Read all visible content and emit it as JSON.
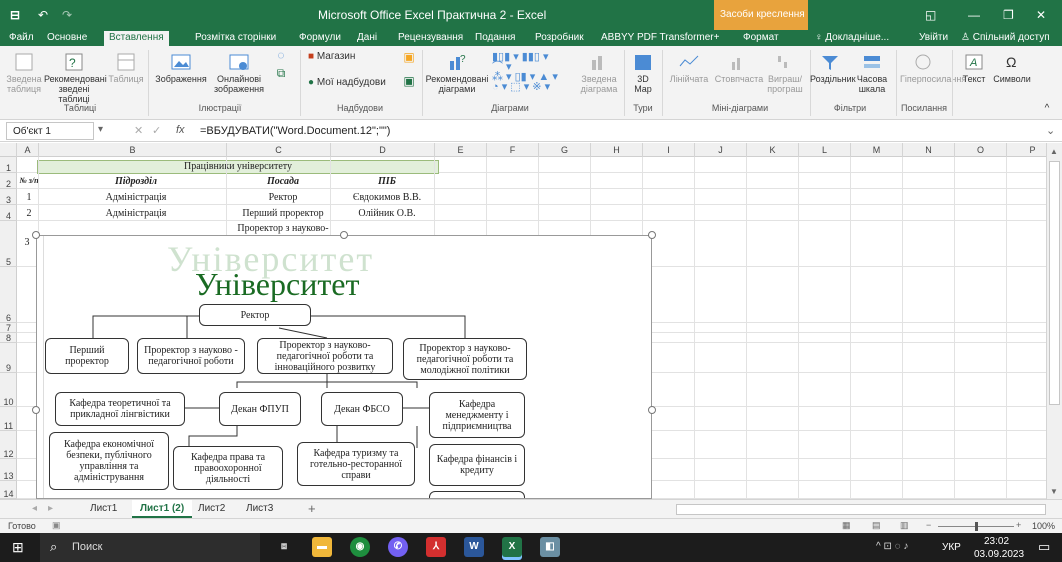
{
  "window": {
    "title": "Microsoft Office Excel Практична 2 - Excel",
    "tools_context": "Засоби креслення",
    "qat_undo": "↶",
    "qat_redo": "↷",
    "min": "—",
    "max": "❐",
    "close": "✕",
    "restore": "◱"
  },
  "tabs": [
    "Файл",
    "Основне",
    "Вставлення",
    "Розмітка сторінки",
    "Формули",
    "Дані",
    "Рецензування",
    "Подання",
    "Розробник",
    "ABBYY PDF Transformer+",
    "Формат"
  ],
  "tell_me": "Докладніше...",
  "sign_in": "Увійти",
  "share": "Спільний доступ",
  "ribbon": {
    "pivot": "Зведена таблиця",
    "rec_pivot": "Рекомендовані зведені таблиці",
    "table": "Таблиця",
    "pictures": "Зображення",
    "online_pictures": "Онлайнові зображення",
    "store": "Магазин",
    "my_addins": "Мої надбудови",
    "rec_charts": "Рекомендовані діаграми",
    "pivot_chart": "Зведена діаграма",
    "map3d": "3D Map",
    "line": "Лінійчата",
    "column": "Стовпчаста",
    "winloss": "Виграш/програш",
    "slicer": "Роздільник",
    "timeline": "Часова шкала",
    "link": "Гіперпосилання",
    "text": "Текст",
    "symbols": "Символи",
    "groups": [
      "Таблиці",
      "Ілюстрації",
      "Надбудови",
      "Діаграми",
      "Тури",
      "Міні-діаграми",
      "Фільтри",
      "Посилання"
    ]
  },
  "formula_bar": {
    "name_box": "Об'єкт 1",
    "fx": "fx",
    "formula": "=ВБУДУВАТИ(\"Word.Document.12\";\"\")"
  },
  "columns": [
    "A",
    "B",
    "C",
    "D",
    "E",
    "F",
    "G",
    "H",
    "I",
    "J",
    "K",
    "L",
    "M",
    "N",
    "O",
    "P"
  ],
  "rows": [
    "1",
    "2",
    "3",
    "4",
    "5",
    "6",
    "7",
    "8",
    "9",
    "10",
    "11",
    "12",
    "13",
    "14"
  ],
  "sheet": {
    "title": "Працівники університету",
    "headers": [
      "№ з/п",
      "Підрозділ",
      "Посада",
      "ПІБ"
    ],
    "r3": [
      "1",
      "Адміністрація",
      "Ректор",
      "Євдокимов В.В."
    ],
    "r4": [
      "2",
      "Адміністрація",
      "Перший проректор",
      "Олійник О.В."
    ],
    "r5_c": "Проректор з науково-",
    "r5_a": "3"
  },
  "diagram": {
    "watermark": "Університет",
    "title": "Університет",
    "rector": "Ректор",
    "l2": [
      "Перший проректор",
      "Проректор з науково - педагогічної роботи",
      "Проректор з науково-педагогічної роботи та інноваційного розвитку",
      "Проректор з науково-педагогічної роботи та молодіжної політики"
    ],
    "dean1": "Декан ФПУП",
    "dean2": "Декан ФБСО",
    "dept": [
      "Кафедра теоретичної та прикладної лінгвістики",
      "Кафедра економічної безпеки, публічного управління та адміністрування",
      "Кафедра права та правоохоронної діяльності",
      "Кафедра туризму та готельно-ресторанної справи",
      "Кафедра менеджменту і підприємництва",
      "Кафедра фінансів і кредиту"
    ],
    "row_nums": [
      "4",
      "5",
      "6",
      "7",
      "8",
      "9",
      "11",
      "12",
      "13"
    ]
  },
  "sheets": [
    "Лист1",
    "Лист1 (2)",
    "Лист2",
    "Лист3"
  ],
  "add_sheet": "+",
  "status": {
    "ready": "Готово",
    "zoom": "100%"
  },
  "taskbar": {
    "search": "Поиск",
    "lang": "УКР",
    "time": "23:02",
    "date": "03.09.2023"
  }
}
